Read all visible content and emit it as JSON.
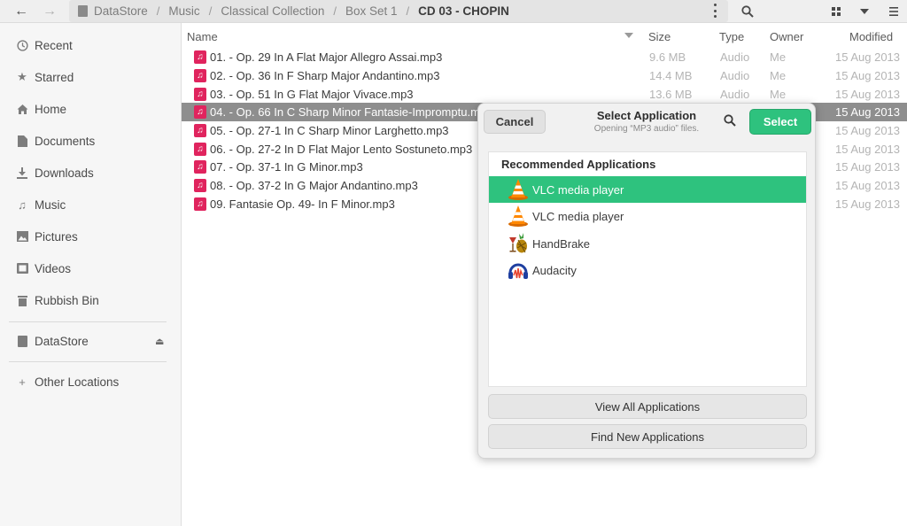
{
  "header": {
    "back_icon": "arrow-left-icon",
    "forward_icon": "arrow-right-icon",
    "breadcrumbs": [
      "DataStore",
      "Music",
      "Classical Collection",
      "Box Set 1",
      "CD 03 - CHOPIN"
    ]
  },
  "sidebar": {
    "items": [
      {
        "label": "Recent",
        "icon": "clock-icon"
      },
      {
        "label": "Starred",
        "icon": "star-icon"
      },
      {
        "label": "Home",
        "icon": "home-icon"
      },
      {
        "label": "Documents",
        "icon": "document-icon"
      },
      {
        "label": "Downloads",
        "icon": "download-icon"
      },
      {
        "label": "Music",
        "icon": "music-icon"
      },
      {
        "label": "Pictures",
        "icon": "picture-icon"
      },
      {
        "label": "Videos",
        "icon": "video-icon"
      },
      {
        "label": "Rubbish Bin",
        "icon": "trash-icon"
      }
    ],
    "drive": {
      "label": "DataStore",
      "icon": "drive-icon"
    },
    "other": {
      "label": "Other Locations",
      "icon": "plus-icon"
    }
  },
  "columns": {
    "name": "Name",
    "size": "Size",
    "type": "Type",
    "owner": "Owner",
    "modified": "Modified"
  },
  "files": [
    {
      "name": "01. - Op. 29 In A Flat Major Allegro Assai.mp3",
      "size": "9.6 MB",
      "type": "Audio",
      "owner": "Me",
      "modified": "15 Aug 2013"
    },
    {
      "name": "02. - Op. 36 In F Sharp Major Andantino.mp3",
      "size": "14.4 MB",
      "type": "Audio",
      "owner": "Me",
      "modified": "15 Aug 2013"
    },
    {
      "name": "03. - Op. 51 In G Flat Major Vivace.mp3",
      "size": "13.6 MB",
      "type": "Audio",
      "owner": "Me",
      "modified": "15 Aug 2013"
    },
    {
      "name": "04. - Op. 66 In C Sharp Minor Fantasie-Impromptu.mp3",
      "size": "",
      "type": "",
      "owner": "",
      "modified": "15 Aug 2013"
    },
    {
      "name": "05. - Op. 27-1 In C Sharp Minor Larghetto.mp3",
      "size": "",
      "type": "",
      "owner": "",
      "modified": "15 Aug 2013"
    },
    {
      "name": "06. - Op. 27-2 In D Flat Major Lento Sostuneto.mp3",
      "size": "",
      "type": "",
      "owner": "",
      "modified": "15 Aug 2013"
    },
    {
      "name": "07. - Op. 37-1 In G Minor.mp3",
      "size": "",
      "type": "",
      "owner": "",
      "modified": "15 Aug 2013"
    },
    {
      "name": "08. - Op. 37-2 In G Major Andantino.mp3",
      "size": "",
      "type": "",
      "owner": "",
      "modified": "15 Aug 2013"
    },
    {
      "name": "09. Fantasie Op. 49- In F Minor.mp3",
      "size": "",
      "type": "",
      "owner": "",
      "modified": "15 Aug 2013"
    }
  ],
  "dialog": {
    "cancel": "Cancel",
    "title": "Select Application",
    "subtitle": "Opening “MP3 audio” files.",
    "select": "Select",
    "recommended_heading": "Recommended Applications",
    "apps": [
      {
        "name": "VLC media player",
        "icon": "vlc-icon"
      },
      {
        "name": "VLC media player",
        "icon": "vlc-icon"
      },
      {
        "name": "HandBrake",
        "icon": "handbrake-icon"
      },
      {
        "name": "Audacity",
        "icon": "audacity-icon"
      }
    ],
    "view_all": "View All Applications",
    "find_new": "Find New Applications"
  },
  "colors": {
    "accent_green": "#2ec27e",
    "file_icon_pink": "#e0245e",
    "selection_gray": "#8e8e8e"
  }
}
